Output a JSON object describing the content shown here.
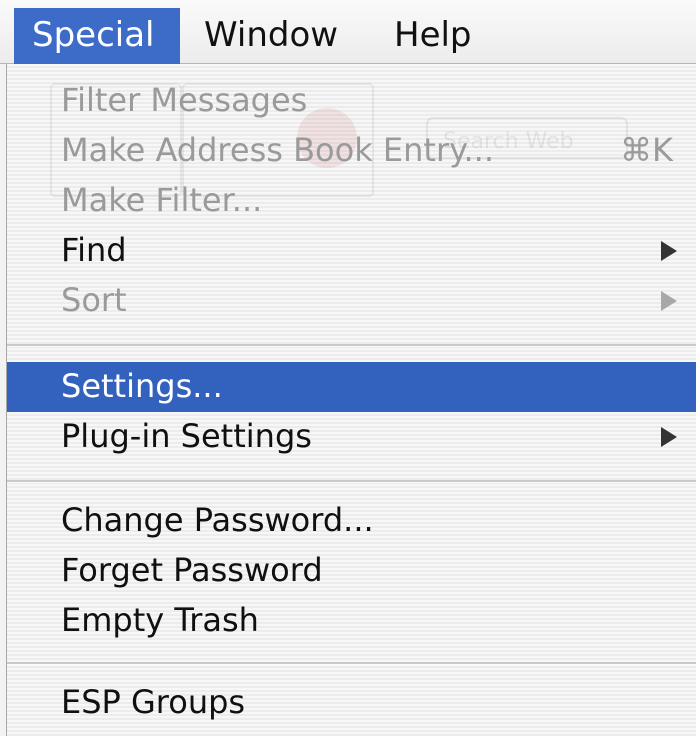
{
  "menubar": {
    "items": [
      {
        "label": "Special",
        "active": true
      },
      {
        "label": "Window",
        "active": false
      },
      {
        "label": "Help",
        "active": false
      }
    ]
  },
  "menu": {
    "items": [
      {
        "label": "Filter Messages",
        "enabled": false
      },
      {
        "label": "Make Address Book Entry...",
        "enabled": false,
        "shortcut": "⌘K"
      },
      {
        "label": "Make Filter...",
        "enabled": false
      },
      {
        "label": "Find",
        "enabled": true,
        "submenu": true
      },
      {
        "label": "Sort",
        "enabled": false,
        "submenu": true
      },
      {
        "label": "Settings...",
        "enabled": true,
        "selected": true
      },
      {
        "label": "Plug-in Settings",
        "enabled": true,
        "submenu": true
      },
      {
        "label": "Change Password...",
        "enabled": true
      },
      {
        "label": "Forget Password",
        "enabled": true
      },
      {
        "label": "Empty Trash",
        "enabled": true
      },
      {
        "label": "ESP Groups",
        "enabled": true
      }
    ]
  },
  "background_toolbar": {
    "search_placeholder": "Search Web"
  },
  "colors": {
    "highlight": "#3262be",
    "menubar_active": "#3d6cc8",
    "disabled_text": "#9a9a9a"
  }
}
